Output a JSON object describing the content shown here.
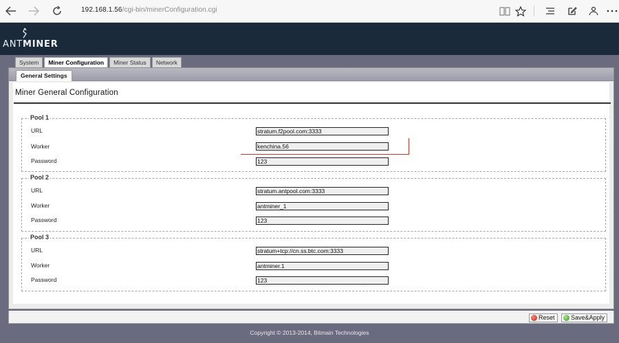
{
  "browser": {
    "url_host": "192.168.1.56",
    "url_path": "/cgi-bin/minerConfiguration.cgi"
  },
  "logo": {
    "text_light": "ANT",
    "text_bold": "MINER"
  },
  "tabs": [
    {
      "label": "System",
      "active": false
    },
    {
      "label": "Miner Configuration",
      "active": true
    },
    {
      "label": "Miner Status",
      "active": false
    },
    {
      "label": "Network",
      "active": false
    }
  ],
  "subtab": {
    "label": "General Settings"
  },
  "page_title": "Miner General Configuration",
  "pools": [
    {
      "legend": "Pool 1",
      "url_label": "URL",
      "url_value": "stratum.f2pool.com:3333",
      "worker_label": "Worker",
      "worker_value": "kenchina.56",
      "password_label": "Password",
      "password_value": "123"
    },
    {
      "legend": "Pool 2",
      "url_label": "URL",
      "url_value": "stratum.antpool.com:3333",
      "worker_label": "Worker",
      "worker_value": "antminer_1",
      "password_label": "Password",
      "password_value": "123"
    },
    {
      "legend": "Pool 3",
      "url_label": "URL",
      "url_value": "stratum+tcp://cn.ss.btc.com:3333",
      "worker_label": "Worker",
      "worker_value": "antminer.1",
      "password_label": "Password",
      "password_value": "123"
    }
  ],
  "buttons": {
    "reset": "Reset",
    "save": "Save&Apply"
  },
  "footer": "Copyright © 2013-2014, Bitmain Technologies",
  "colors": {
    "header_bg": "#1a2a3a",
    "page_bg": "#6b6b80",
    "annotation": "#c0392b"
  },
  "icons": [
    "back-arrow-icon",
    "forward-arrow-icon",
    "refresh-icon",
    "reading-view-icon",
    "favorite-star-icon",
    "hub-icon",
    "web-note-icon",
    "share-icon",
    "more-icon"
  ]
}
